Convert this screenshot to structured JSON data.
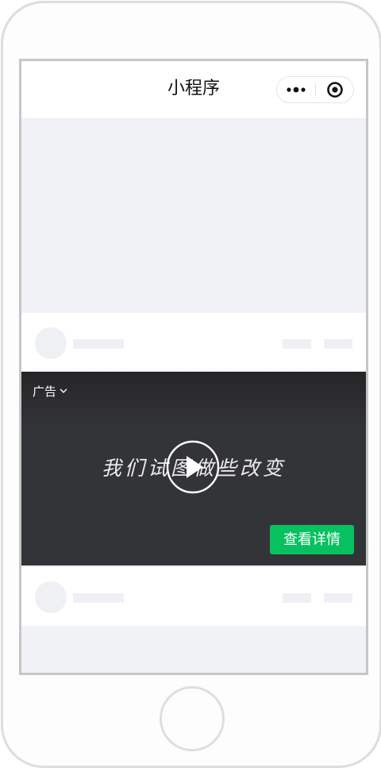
{
  "navbar": {
    "title": "小程序",
    "more_icon": "more-dots-icon",
    "close_icon": "target-circle-icon"
  },
  "ad": {
    "label": "广告",
    "label_icon": "chevron-down-icon",
    "video_text": "我们试图做些改变",
    "play_icon": "play-circle-icon",
    "cta_label": "查看详情",
    "cta_color": "#07c160"
  },
  "colors": {
    "page_bg": "#f1f2f6",
    "placeholder": "#eef0f4",
    "ad_bg": "#333437"
  }
}
